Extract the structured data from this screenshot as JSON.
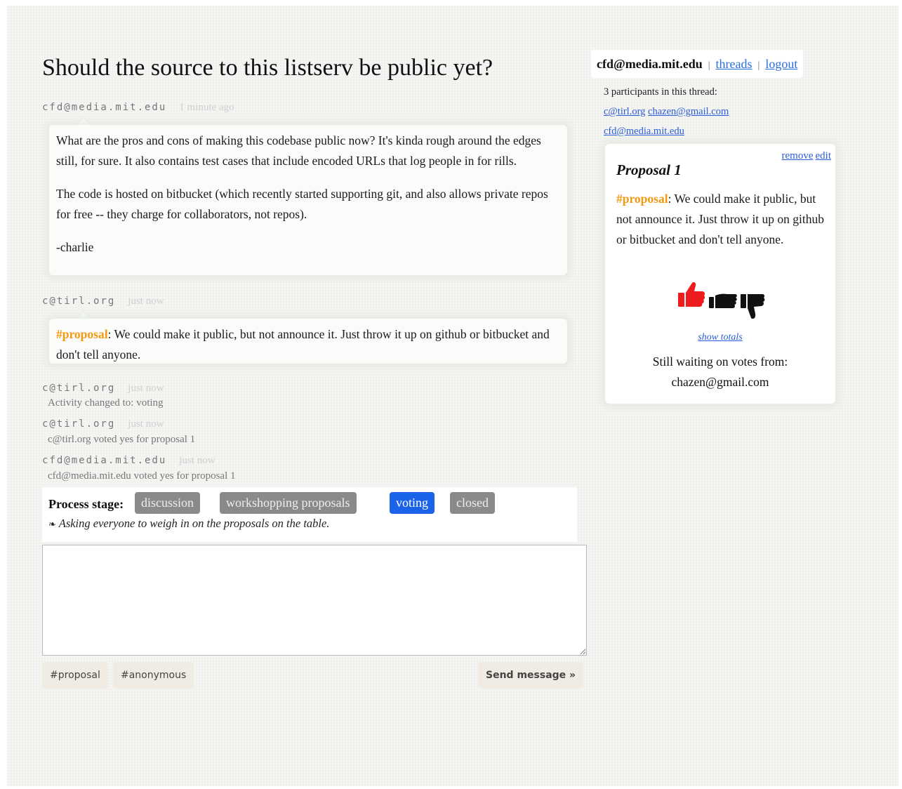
{
  "thread": {
    "title": "Should the source to this listserv be public yet?"
  },
  "messages": [
    {
      "author": "cfd@media.mit.edu",
      "time": "1 minute ago",
      "paragraphs": [
        "What are the pros and cons of making this codebase public now? It's kinda rough around the edges still, for sure. It also contains test cases that include encoded URLs that log people in for rills.",
        "The code is hosted on bitbucket (which recently started supporting git, and also allows private repos for free -- they charge for collaborators, not repos).",
        "-charlie"
      ]
    },
    {
      "author": "c@tirl.org",
      "time": "just now",
      "tag": "#proposal",
      "text": ": We could make it public, but not announce it. Just throw it up on github or bitbucket and don't tell anyone."
    }
  ],
  "activities": [
    {
      "author": "c@tirl.org",
      "time": "just now",
      "text": "Activity changed to: voting"
    },
    {
      "author": "c@tirl.org",
      "time": "just now",
      "text": "c@tirl.org voted yes for proposal 1"
    },
    {
      "author": "cfd@media.mit.edu",
      "time": "just now",
      "text": "cfd@media.mit.edu voted yes for proposal 1"
    }
  ],
  "process": {
    "label": "Process stage:",
    "stages": [
      "discussion",
      "workshopping proposals",
      "voting",
      "closed"
    ],
    "active": "voting",
    "description": "Asking everyone to weigh in on the proposals on the table.",
    "description_icon": "leaf-bullet-icon"
  },
  "composer": {
    "placeholder": "",
    "buttons": [
      "#proposal",
      "#anonymous"
    ],
    "send_label": "Send message »"
  },
  "userbar": {
    "user": "cfd@media.mit.edu",
    "sep": "|",
    "threads_link": "threads",
    "logout_link": "logout"
  },
  "participants": {
    "summary": "3 participants in this thread:",
    "list": [
      "c@tirl.org",
      "chazen@gmail.com",
      "cfd@media.mit.edu"
    ]
  },
  "proposal": {
    "remove_link": "remove",
    "edit_link": "edit",
    "title": "Proposal 1",
    "tag": "#proposal",
    "text": ": We could make it public, but not announce it. Just throw it up on github or bitbucket and don't tell anyone.",
    "votes": {
      "yes_icon": "thumbs-up-icon",
      "abstain_icon": "thumbs-sideways-icon",
      "no_icon": "thumbs-down-icon",
      "selected": "yes",
      "selected_color": "#ee1c1c",
      "unselected_color": "#111111"
    },
    "show_totals_link": "show totals",
    "waiting_label": "Still waiting on votes from:",
    "waiting_on": "chazen@gmail.com"
  },
  "colors": {
    "tag": "#f29a12",
    "active_stage": "#1a63e8",
    "inactive_stage": "#8a8a8a",
    "link": "#2a5bd8"
  }
}
